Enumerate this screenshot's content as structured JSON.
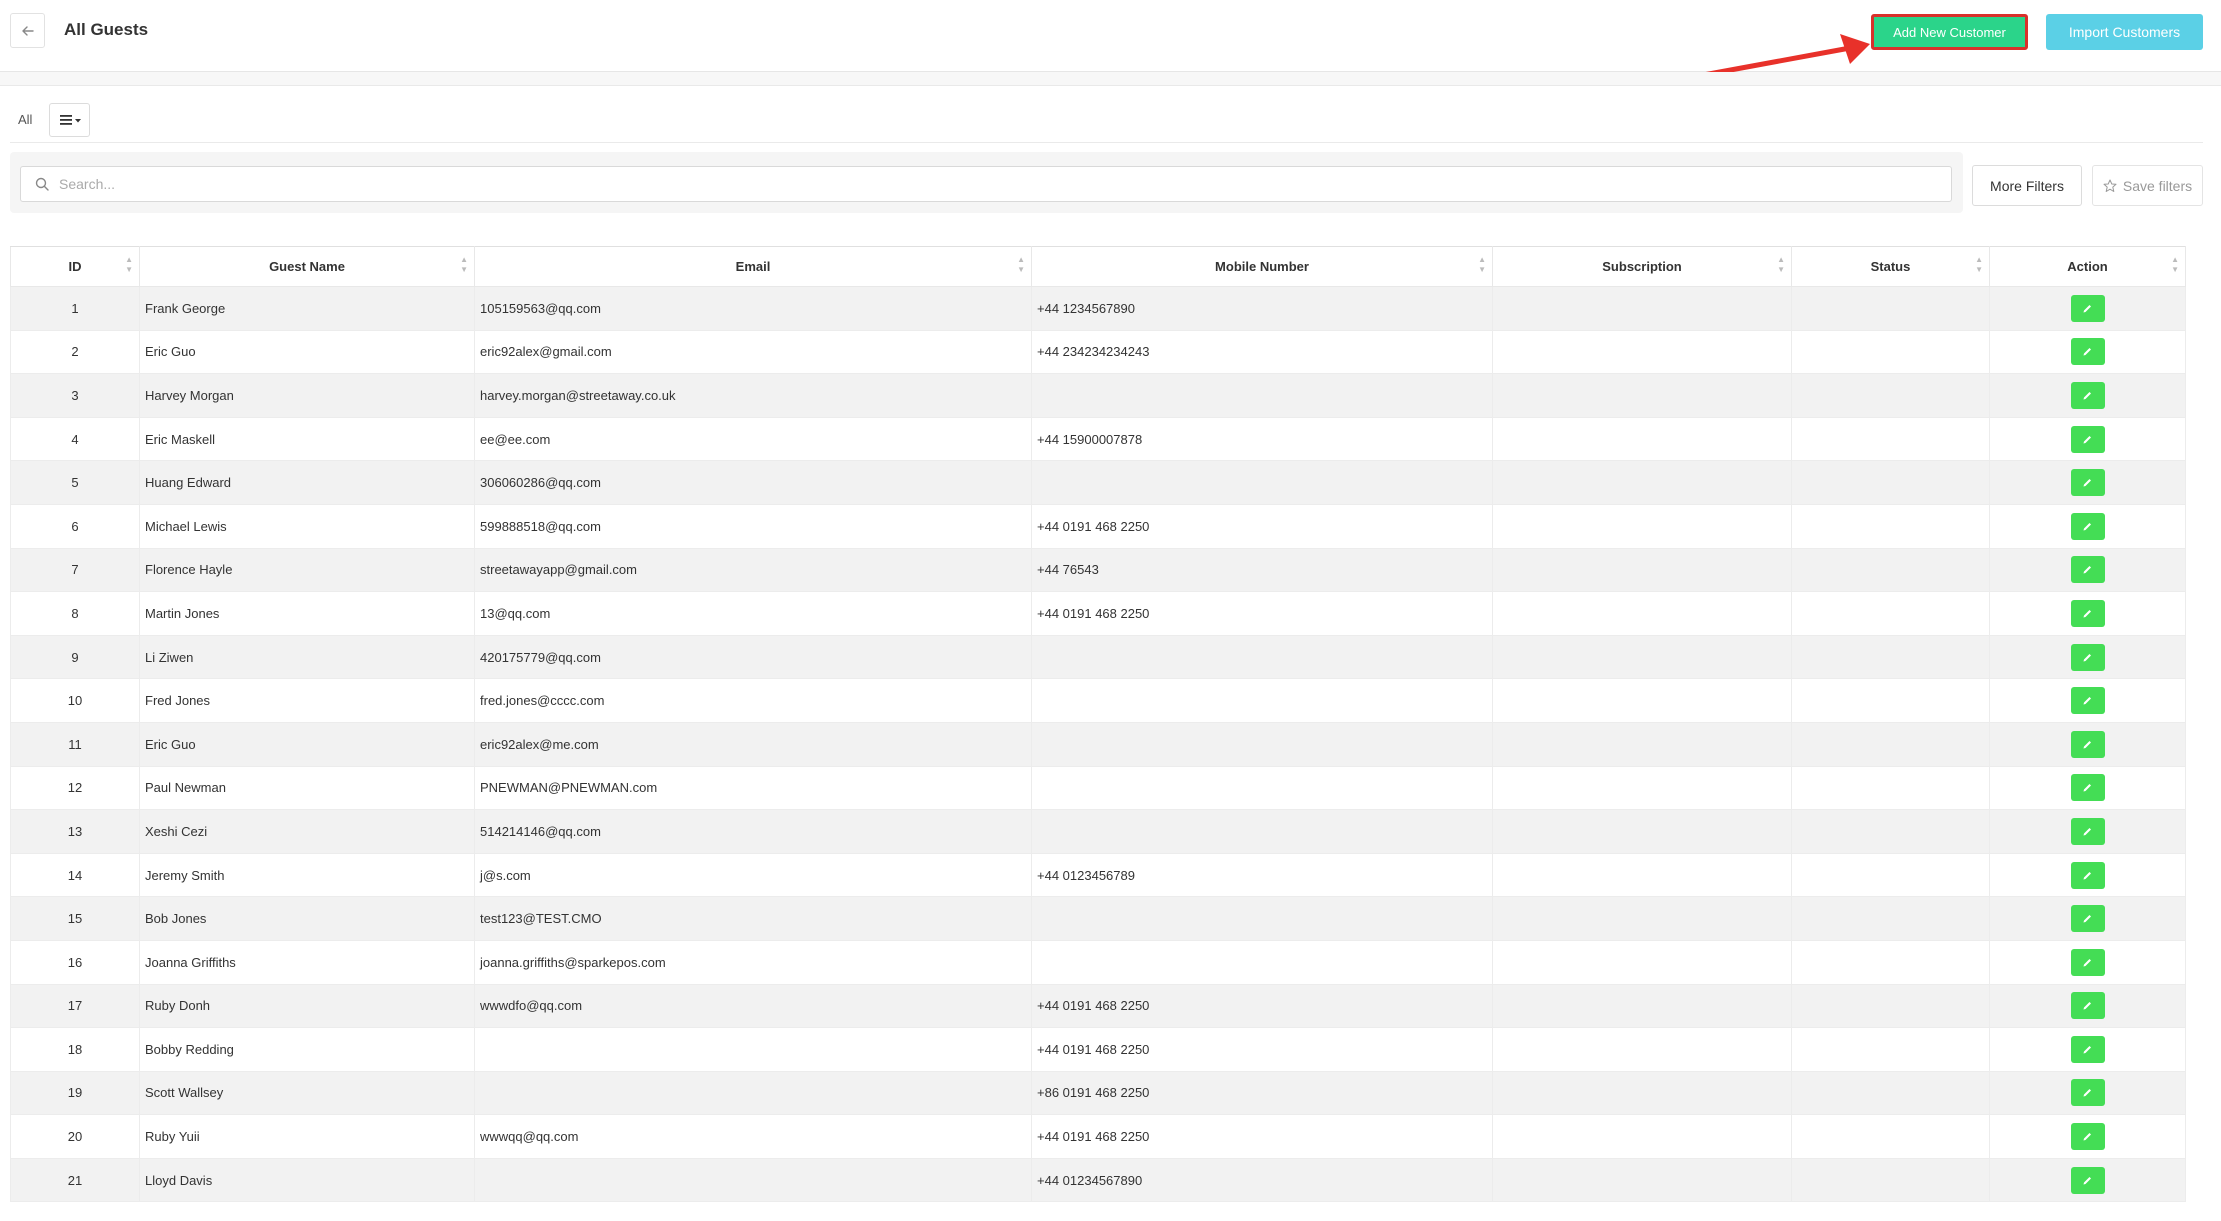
{
  "header": {
    "title": "All Guests",
    "add_button": "Add New Customer",
    "import_button": "Import Customers"
  },
  "view": {
    "all_label": "All"
  },
  "filters": {
    "search_placeholder": "Search...",
    "more_filters": "More Filters",
    "save_filters": "Save filters"
  },
  "table": {
    "columns": [
      "ID",
      "Guest Name",
      "Email",
      "Mobile Number",
      "Subscription",
      "Status",
      "Action"
    ],
    "rows": [
      {
        "id": "1",
        "name": "Frank George",
        "email": "105159563@qq.com",
        "mobile": "+44 1234567890",
        "subscription": "",
        "status": ""
      },
      {
        "id": "2",
        "name": "Eric Guo",
        "email": "eric92alex@gmail.com",
        "mobile": "+44 234234234243",
        "subscription": "",
        "status": ""
      },
      {
        "id": "3",
        "name": "Harvey Morgan",
        "email": "harvey.morgan@streetaway.co.uk",
        "mobile": "",
        "subscription": "",
        "status": ""
      },
      {
        "id": "4",
        "name": "Eric Maskell",
        "email": "ee@ee.com",
        "mobile": "+44 15900007878",
        "subscription": "",
        "status": ""
      },
      {
        "id": "5",
        "name": "Huang Edward",
        "email": "306060286@qq.com",
        "mobile": "",
        "subscription": "",
        "status": ""
      },
      {
        "id": "6",
        "name": "Michael Lewis",
        "email": "599888518@qq.com",
        "mobile": "+44 0191 468 2250",
        "subscription": "",
        "status": ""
      },
      {
        "id": "7",
        "name": "Florence Hayle",
        "email": "streetawayapp@gmail.com",
        "mobile": "+44 76543",
        "subscription": "",
        "status": ""
      },
      {
        "id": "8",
        "name": "Martin Jones",
        "email": "13@qq.com",
        "mobile": "+44 0191 468 2250",
        "subscription": "",
        "status": ""
      },
      {
        "id": "9",
        "name": "Li Ziwen",
        "email": "420175779@qq.com",
        "mobile": "",
        "subscription": "",
        "status": ""
      },
      {
        "id": "10",
        "name": "Fred Jones",
        "email": "fred.jones@cccc.com",
        "mobile": "",
        "subscription": "",
        "status": ""
      },
      {
        "id": "11",
        "name": "Eric Guo",
        "email": "eric92alex@me.com",
        "mobile": "",
        "subscription": "",
        "status": ""
      },
      {
        "id": "12",
        "name": "Paul Newman",
        "email": "PNEWMAN@PNEWMAN.com",
        "mobile": "",
        "subscription": "",
        "status": ""
      },
      {
        "id": "13",
        "name": "Xeshi Cezi",
        "email": "514214146@qq.com",
        "mobile": "",
        "subscription": "",
        "status": ""
      },
      {
        "id": "14",
        "name": "Jeremy Smith",
        "email": "j@s.com",
        "mobile": "+44 0123456789",
        "subscription": "",
        "status": ""
      },
      {
        "id": "15",
        "name": "Bob Jones",
        "email": "test123@TEST.CMO",
        "mobile": "",
        "subscription": "",
        "status": ""
      },
      {
        "id": "16",
        "name": "Joanna Griffiths",
        "email": "joanna.griffiths@sparkepos.com",
        "mobile": "",
        "subscription": "",
        "status": ""
      },
      {
        "id": "17",
        "name": "Ruby Donh",
        "email": "wwwdfo@qq.com",
        "mobile": "+44 0191 468 2250",
        "subscription": "",
        "status": ""
      },
      {
        "id": "18",
        "name": "Bobby Redding",
        "email": "",
        "mobile": "+44 0191 468 2250",
        "subscription": "",
        "status": ""
      },
      {
        "id": "19",
        "name": "Scott Wallsey",
        "email": "",
        "mobile": "+86 0191 468 2250",
        "subscription": "",
        "status": ""
      },
      {
        "id": "20",
        "name": "Ruby Yuii",
        "email": "wwwqq@qq.com",
        "mobile": "+44 0191 468 2250",
        "subscription": "",
        "status": ""
      },
      {
        "id": "21",
        "name": "Lloyd Davis",
        "email": "",
        "mobile": "+44 01234567890",
        "subscription": "",
        "status": ""
      }
    ]
  },
  "icons": {
    "back": "arrow-left-icon",
    "menu": "list-menu-icon",
    "search": "search-icon",
    "star": "star-icon",
    "edit": "pencil-icon",
    "sort": "sort-arrows-icon"
  },
  "colors": {
    "add_button": "#2bd48a",
    "add_button_highlight": "#d9302b",
    "import_button": "#5bd0e6",
    "edit_button": "#44dd55",
    "annotation_arrow": "#e8312a"
  }
}
